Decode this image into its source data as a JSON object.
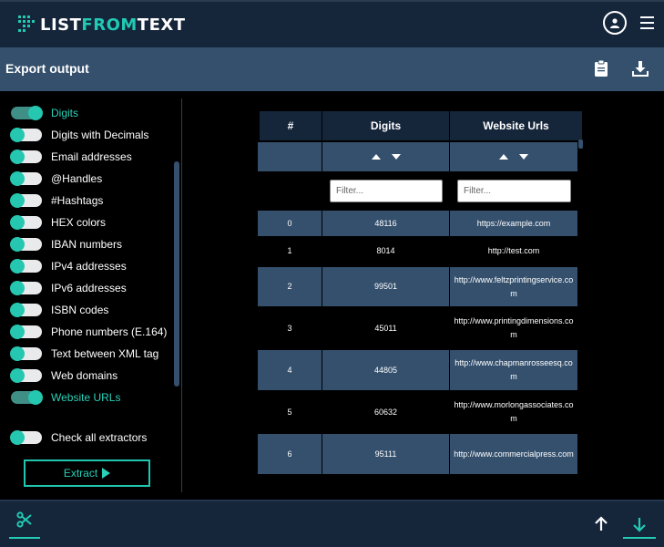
{
  "app": {
    "logo_prefix": "LIST",
    "logo_accent": "FROM",
    "logo_suffix": "TEXT"
  },
  "header": {
    "title": "Export output"
  },
  "sidebar": {
    "toggles": [
      {
        "label": "Digits",
        "on": true
      },
      {
        "label": "Digits with Decimals",
        "on": false
      },
      {
        "label": "Email addresses",
        "on": false
      },
      {
        "label": "@Handles",
        "on": false
      },
      {
        "label": "#Hashtags",
        "on": false
      },
      {
        "label": "HEX colors",
        "on": false
      },
      {
        "label": "IBAN numbers",
        "on": false
      },
      {
        "label": "IPv4 addresses",
        "on": false
      },
      {
        "label": "IPv6 addresses",
        "on": false
      },
      {
        "label": "ISBN codes",
        "on": false
      },
      {
        "label": "Phone numbers (E.164)",
        "on": false
      },
      {
        "label": "Text between XML tag",
        "on": false
      },
      {
        "label": "Web domains",
        "on": false
      },
      {
        "label": "Website URLs",
        "on": true
      }
    ],
    "check_all_label": "Check all extractors",
    "extract_label": "Extract"
  },
  "table": {
    "headers": [
      "#",
      "Digits",
      "Website Urls"
    ],
    "filter_placeholder": "Filter...",
    "rows": [
      {
        "index": "0",
        "digits": "48116",
        "url": "https://example.com"
      },
      {
        "index": "1",
        "digits": "8014",
        "url": "http://test.com"
      },
      {
        "index": "2",
        "digits": "99501",
        "url": "http://www.feltzprintingservice.com"
      },
      {
        "index": "3",
        "digits": "45011",
        "url": "http://www.printingdimensions.com"
      },
      {
        "index": "4",
        "digits": "44805",
        "url": "http://www.chapmanrosseesq.com"
      },
      {
        "index": "5",
        "digits": "60632",
        "url": "http://www.morlongassociates.com"
      },
      {
        "index": "6",
        "digits": "95111",
        "url": "http://www.commercialpress.com"
      }
    ]
  },
  "icons": {
    "user": "user-circle-icon",
    "menu": "hamburger-menu-icon",
    "clipboard": "clipboard-icon",
    "download": "download-icon",
    "scissors": "scissors-icon",
    "arrow_up": "arrow-up-icon",
    "arrow_down": "arrow-down-icon"
  },
  "colors": {
    "accent": "#22c9b3",
    "topbar": "#15253a",
    "header": "#34506d",
    "row_shade": "#34506d"
  }
}
